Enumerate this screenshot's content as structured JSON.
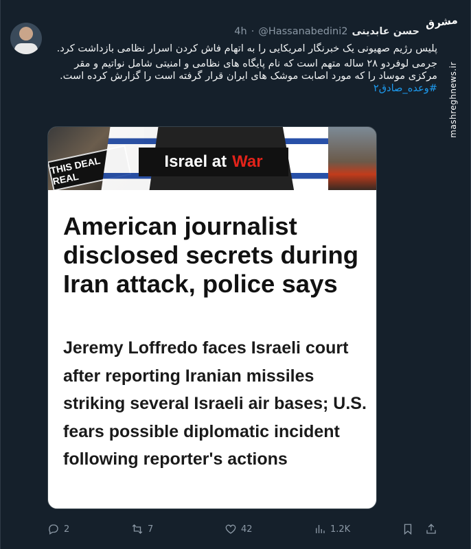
{
  "tweet": {
    "author_name": "حسن عابدینی",
    "handle": "@Hassanabedini2",
    "separator": "·",
    "time": "4h",
    "paragraph1": "پلیس رژیم صهیونی یک خبرنگار امریکایی را به اتهام فاش کردن اسرار نظامی بازداشت کرد.",
    "paragraph2": "جرمی لوفردو ۲۸ ساله متهم است که نام پایگاه های نظامی و امنیتی شامل نواتیم و مقر مرکزی موساد را که مورد اصابت موشک های ایران قرار گرفته است را گزارش کرده است.",
    "hashtag": "#وعده_صادق۲"
  },
  "card": {
    "sign_text": "THIS DEAL REAL",
    "banner_word1": "Israel at",
    "banner_word2": "War",
    "headline": "American journalist disclosed secrets during Iran attack, police says",
    "subhead": "Jeremy Loffredo faces Israeli court after reporting Iranian missiles striking several Israeli air bases; U.S. fears possible diplomatic incident following reporter's actions"
  },
  "actions": {
    "replies": "2",
    "retweets": "7",
    "likes": "42",
    "views": "1.2K"
  },
  "watermark": {
    "logo_text": "مشرق",
    "side_url": "mashreghnews.ir"
  },
  "colors": {
    "background": "#15202b",
    "link": "#1d9bf0",
    "muted": "#8b98a5",
    "war_red": "#e2231a"
  }
}
